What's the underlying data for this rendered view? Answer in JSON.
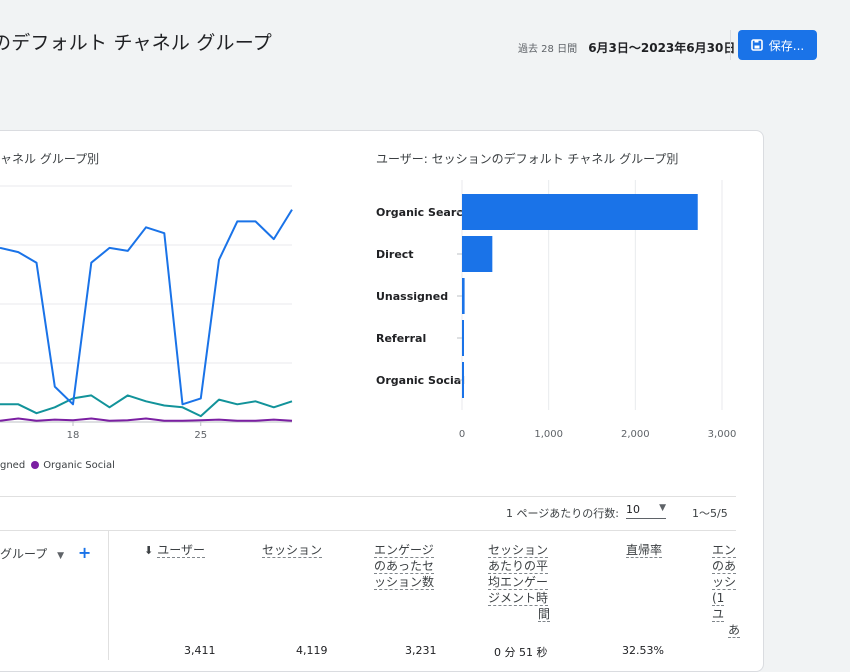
{
  "header": {
    "title": "のデフォルト チャネル グループ",
    "date_label": "過去 28 日間",
    "date_value": "6月3日～2023年6月30日",
    "save_label": "保存..."
  },
  "line_chart": {
    "title": "ャネル グループ別",
    "x_ticks": [
      "18",
      "25"
    ],
    "legend_partial": "gned",
    "legend_item": "Organic Social"
  },
  "bar_chart": {
    "title": "ユーザー: セッションのデフォルト チャネル グループ別"
  },
  "chart_data": [
    {
      "type": "line",
      "title": "ャネル グループ別",
      "x_ticks": [
        "18",
        "25"
      ],
      "series": [
        {
          "values": [
            2950,
            2880,
            2700,
            600,
            300,
            2700,
            2950,
            2900,
            3300,
            3200,
            300,
            400,
            2750,
            3400,
            3400,
            3100,
            3600
          ]
        },
        {
          "values": [
            300,
            300,
            150,
            250,
            400,
            450,
            250,
            450,
            350,
            280,
            250,
            100,
            380,
            300,
            350,
            250,
            350
          ]
        },
        {
          "name": "Organic Social",
          "values": [
            20,
            60,
            20,
            40,
            30,
            60,
            20,
            30,
            60,
            20,
            20,
            30,
            40,
            20,
            20,
            40,
            20
          ]
        }
      ],
      "colors": [
        "#1a73e8",
        "#12939a",
        "#7b1fa2"
      ]
    },
    {
      "type": "bar",
      "title": "ユーザー: セッションのデフォルト チャネル グループ別",
      "orientation": "horizontal",
      "categories": [
        "Organic Search",
        "Direct",
        "Unassigned",
        "Referral",
        "Organic Social"
      ],
      "values": [
        2720,
        350,
        30,
        20,
        5
      ],
      "x_ticks": [
        "0",
        "1,000",
        "2,000",
        "3,000"
      ],
      "xlim": [
        0,
        3000
      ],
      "color": "#1a73e8"
    }
  ],
  "table": {
    "rows_per_page_label": "1 ページあたりの行数:",
    "rows_per_page_value": "10",
    "pagination": "1～5/5",
    "dimension_header": "グループ",
    "columns": [
      {
        "lines": [
          "ユーザー"
        ]
      },
      {
        "lines": [
          "セッション"
        ]
      },
      {
        "lines": [
          "エンゲージ",
          "のあったセ",
          "ッション数"
        ]
      },
      {
        "lines": [
          "セッション",
          "あたりの平",
          "均エンゲー",
          "ジメント時",
          "間"
        ]
      },
      {
        "lines": [
          "直帰率"
        ]
      },
      {
        "lines": [
          "エン",
          "のあ",
          "ッシ",
          "(1 ユ",
          "あ"
        ]
      }
    ],
    "first_row_partial": [
      "3,411",
      "4,119",
      "3,231",
      "0 分 51 秒",
      "32.53%"
    ]
  }
}
